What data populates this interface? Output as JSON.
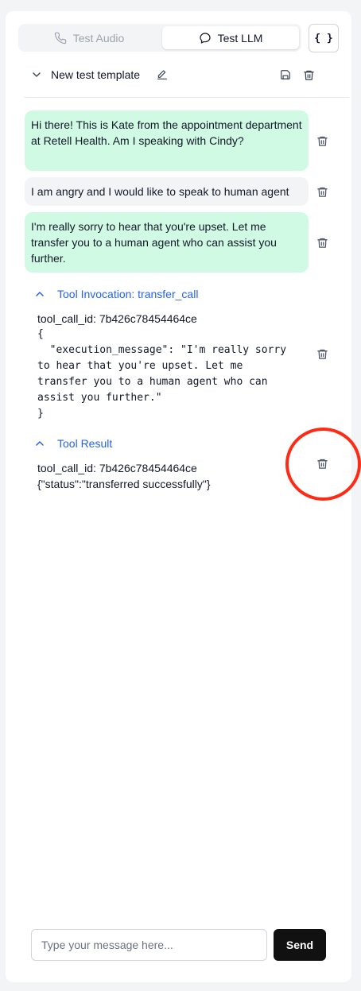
{
  "tabs": [
    {
      "label": "Test Audio",
      "icon": "phone-icon",
      "active": false
    },
    {
      "label": "Test LLM",
      "icon": "chat-bubble-icon",
      "active": true
    }
  ],
  "json_button_label": "{ }",
  "template": {
    "name": "New test template"
  },
  "messages": [
    {
      "role": "agent",
      "text": "Hi there! This is Kate from the appointment department at Retell Health. Am I speaking with Cindy?"
    },
    {
      "role": "user",
      "text": "I am angry and I would like to speak to human agent"
    },
    {
      "role": "agent",
      "text": "I'm really sorry to hear that you're upset. Let me transfer you to a human agent who can assist you further."
    }
  ],
  "tool_invocation": {
    "title": "Tool Invocation: transfer_call",
    "call_id_line": "tool_call_id: 7b426c78454464ce",
    "args_lines": [
      "{",
      "  \"execution_message\": \"I'm really sorry",
      "to hear that you're upset. Let me",
      "transfer you to a human agent who can",
      "assist you further.\"",
      "}"
    ]
  },
  "tool_result": {
    "title": "Tool Result",
    "call_id_line": "tool_call_id: 7b426c78454464ce",
    "result_line": "{\"status\":\"transferred successfully\"}"
  },
  "composer": {
    "placeholder": "Type your message here...",
    "send_label": "Send"
  },
  "colors": {
    "agent_bubble": "#d1fae5",
    "user_bubble": "#f3f4f6",
    "link_blue": "#2563eb",
    "highlight_circle": "#ff2a14",
    "send_bg": "#111111"
  }
}
